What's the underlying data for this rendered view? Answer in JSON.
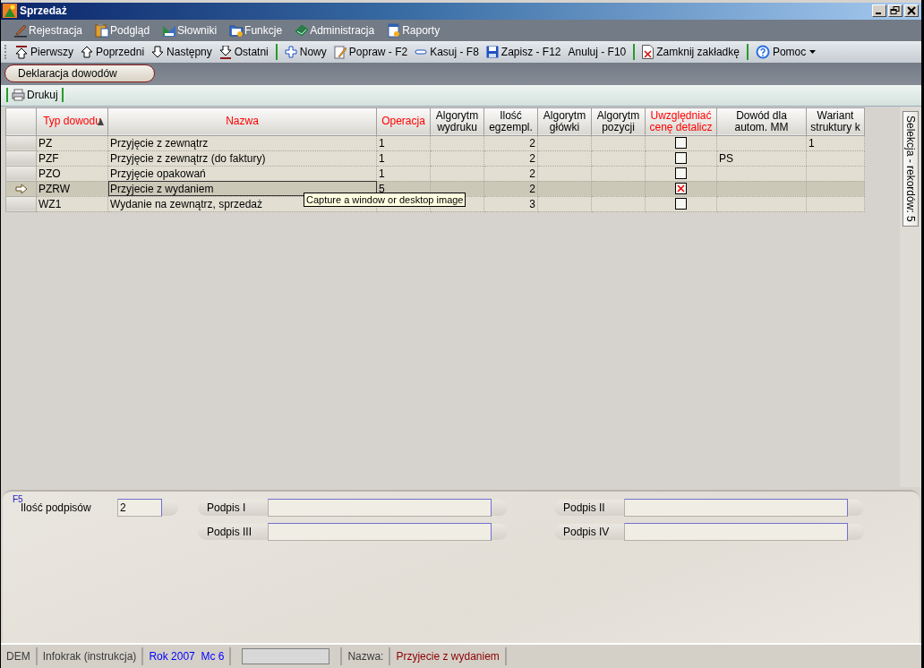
{
  "window": {
    "title": "Sprzedaż"
  },
  "menu": [
    {
      "label": "Rejestracja"
    },
    {
      "label": "Podgląd"
    },
    {
      "label": "Słowniki"
    },
    {
      "label": "Funkcje"
    },
    {
      "label": "Administracja"
    },
    {
      "label": "Raporty"
    }
  ],
  "toolbar": [
    {
      "kind": "button",
      "label": "Pierwszy"
    },
    {
      "kind": "button",
      "label": "Poprzedni"
    },
    {
      "kind": "button",
      "label": "Następny"
    },
    {
      "kind": "button",
      "label": "Ostatni"
    },
    {
      "kind": "separator"
    },
    {
      "kind": "button",
      "label": "Nowy"
    },
    {
      "kind": "button",
      "label": "Popraw - F2"
    },
    {
      "kind": "button",
      "label": "Kasuj - F8"
    },
    {
      "kind": "button",
      "label": "Zapisz - F12"
    },
    {
      "kind": "button",
      "label": "Anuluj - F10"
    },
    {
      "kind": "separator"
    },
    {
      "kind": "button",
      "label": "Zamknij zakładkę"
    },
    {
      "kind": "separator"
    },
    {
      "kind": "menu",
      "label": "Pomoc"
    }
  ],
  "tabs": [
    {
      "label": "Deklaracja dowodów",
      "selected": true
    }
  ],
  "print_toolbar": [
    {
      "label": "Drukuj"
    }
  ],
  "table": {
    "columns": [
      {
        "label": "Typ dowodu",
        "required": true,
        "sorted": true
      },
      {
        "label": "Nazwa",
        "required": true,
        "sorted": false
      },
      {
        "label": "Operacja",
        "required": true,
        "sorted": false
      },
      {
        "label": "Algorytm wydruku",
        "required": false,
        "sorted": false
      },
      {
        "label": "Ilość egzempl.",
        "required": false,
        "sorted": false
      },
      {
        "label": "Algorytm główki",
        "required": false,
        "sorted": false
      },
      {
        "label": "Algorytm pozycji",
        "required": false,
        "sorted": false
      },
      {
        "label": "Uwzględniać cenę detalicz",
        "required": true,
        "sorted": false
      },
      {
        "label": "Dowód dla autom. MM",
        "required": false,
        "sorted": false
      },
      {
        "label": "Wariant struktury k",
        "required": false,
        "sorted": false
      }
    ],
    "rows": [
      {
        "selected": false,
        "code": "PZ",
        "name": "Przyjęcie z zewnątrz",
        "operation": "1",
        "copies": "2",
        "retail_price": false,
        "variant": "1"
      },
      {
        "selected": false,
        "code": "PZF",
        "name": "Przyjęcie z zewnątrz (do faktury)",
        "operation": "1",
        "copies": "2",
        "retail_price": false,
        "mm_document": "PS"
      },
      {
        "selected": false,
        "code": "PZO",
        "name": "Przyjęcie opakowań",
        "operation": "1",
        "copies": "2",
        "retail_price": false
      },
      {
        "selected": true,
        "code": "PZRW",
        "name": "Przyjecie z wydaniem",
        "operation": "5",
        "copies": "2",
        "retail_price": true
      },
      {
        "selected": false,
        "code": "WZ1",
        "name": "Wydanie na zewnątrz, sprzedaż",
        "copies": "3",
        "retail_price": false
      }
    ]
  },
  "tooltip": {
    "text": "Capture a window or desktop image"
  },
  "side_tab": {
    "label": "Selekcja - rekordów: 5"
  },
  "form": {
    "shortcut": "F5",
    "fields": [
      {
        "label": "Ilość podpisów",
        "value": "2"
      },
      {
        "label": "Podpis I"
      },
      {
        "label": "Podpis II"
      },
      {
        "label": "Podpis III"
      },
      {
        "label": "Podpis IV"
      }
    ]
  },
  "status_bar": [
    {
      "kind": "text",
      "text": "DEM",
      "color": "#3a3a3a"
    },
    {
      "kind": "text",
      "text": "Infokrak (instrukcja)",
      "color": "#3a3a3a"
    },
    {
      "kind": "text",
      "text": "Rok 2007  Mc 6",
      "color": "#0000ff"
    },
    {
      "kind": "field"
    },
    {
      "kind": "text",
      "text": "Nazwa:",
      "color": "#3a3a3a"
    },
    {
      "kind": "text",
      "text": "Przyjecie z wydaniem",
      "color": "#8b0000"
    }
  ]
}
